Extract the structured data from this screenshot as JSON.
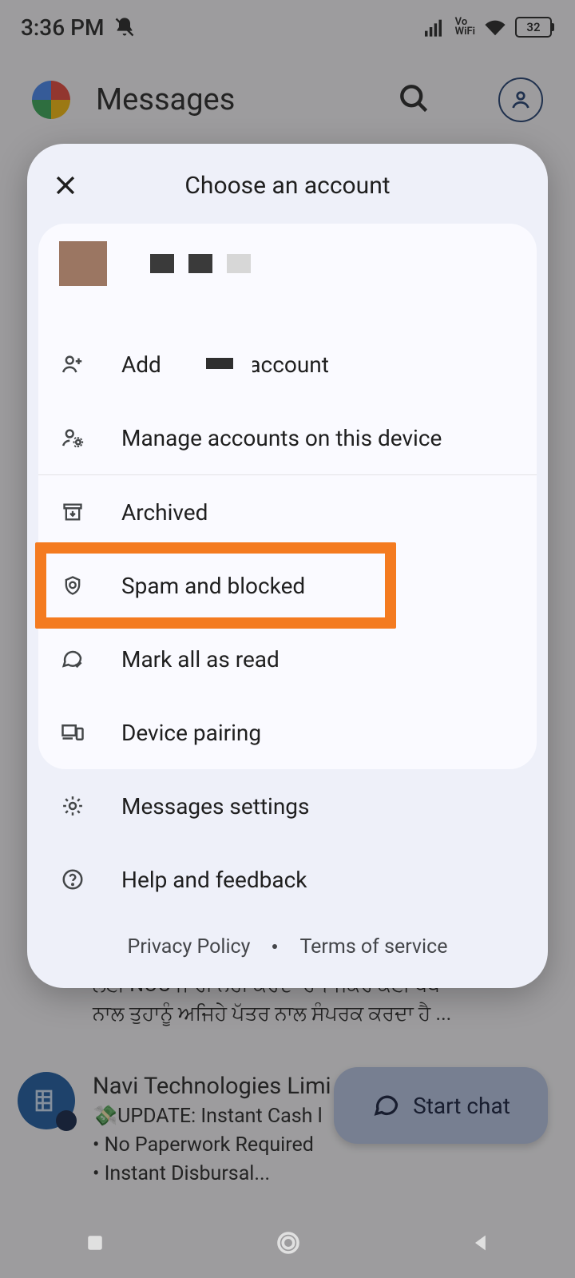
{
  "statusbar": {
    "time": "3:36 PM",
    "battery": "32"
  },
  "app": {
    "title": "Messages"
  },
  "dialog": {
    "title": "Choose an account",
    "add_another": "Add another account",
    "manage": "Manage accounts on this device",
    "archived": "Archived",
    "spam": "Spam and blocked",
    "mark_read": "Mark all as read",
    "device_pairing": "Device pairing",
    "settings": "Messages settings",
    "help": "Help and feedback",
    "privacy": "Privacy Policy",
    "terms": "Terms of service"
  },
  "highlighted_item": "spam",
  "conversations": {
    "c0": "ਲਈ NOC ਜਾਰੀ ਨਹੀਂ ਕਰਦਾ ਹੈ। ਜੇਕਰ ਕੋਈ ਧੋਖੇ\nਨਾਲ ਤੁਹਾਨੂੰ ਅਜਿਹੇ ਪੱਤਰ ਨਾਲ ਸੰਪਰਕ ਕਰਦਾ ਹੈ ...",
    "c1": {
      "name": "Navi Technologies Limi",
      "preview": "💸UPDATE: Instant Cash l\n• No Paperwork Required\n• Instant Disbursal..."
    }
  },
  "fab": "Start chat"
}
